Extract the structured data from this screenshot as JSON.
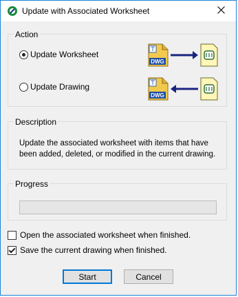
{
  "window": {
    "title": "Update with Associated Worksheet",
    "close_icon": "close-icon"
  },
  "action": {
    "label": "Action",
    "options": [
      {
        "label": "Update Worksheet",
        "selected": true
      },
      {
        "label": "Update Drawing",
        "selected": false
      }
    ],
    "diagram_labels": {
      "dwg": "DWG"
    }
  },
  "description": {
    "label": "Description",
    "text": "Update the associated worksheet with items that have been added, deleted, or modified in the current drawing."
  },
  "progress": {
    "label": "Progress",
    "value": 0
  },
  "options": {
    "open_worksheet": {
      "label": "Open the associated worksheet when finished.",
      "checked": false
    },
    "save_drawing": {
      "label": "Save the current drawing when finished.",
      "checked": true
    }
  },
  "buttons": {
    "start": "Start",
    "cancel": "Cancel"
  },
  "colors": {
    "accent": "#0078d7",
    "arrow": "#1a237e",
    "dwg_yellow": "#f2c94c"
  }
}
